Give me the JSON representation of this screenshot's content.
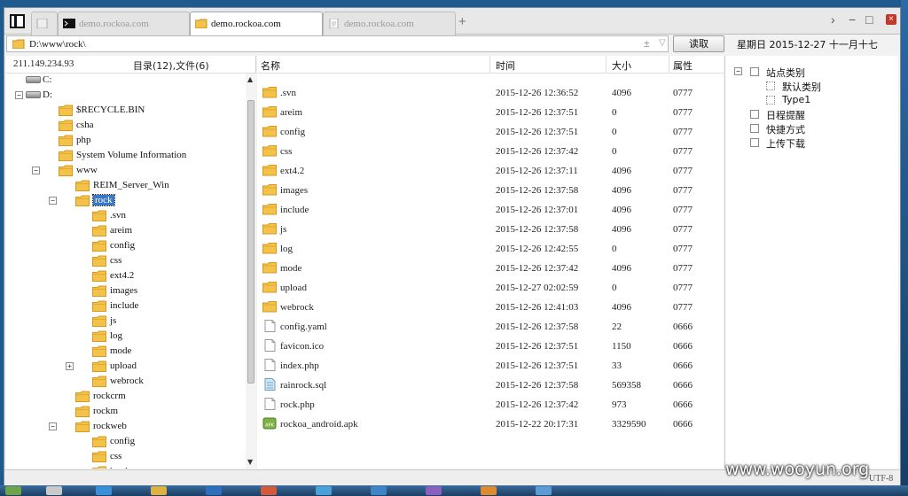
{
  "tabs": [
    {
      "icon": "blank-page-icon",
      "label": ""
    },
    {
      "icon": "terminal-icon",
      "label": "demo.rockoa.com"
    },
    {
      "icon": "folder-icon",
      "label": "demo.rockoa.com",
      "active": true
    },
    {
      "icon": "page-icon",
      "label": "demo.rockoa.com"
    }
  ],
  "toolbar": {
    "add_tab": "+",
    "forward": "›",
    "minimize": "−",
    "maximize": "□",
    "close": "×",
    "address": "D:\\www\\rock\\",
    "address_plusminus": "±",
    "address_dropdown": "▽",
    "read_button": "读取",
    "date": "星期日 2015-12-27 十一月十七"
  },
  "left": {
    "ip": "211.149.234.93",
    "count": "目录(12),文件(6)",
    "tree": [
      {
        "label": "C:",
        "depth": 0,
        "kind": "drive",
        "toggle": ""
      },
      {
        "label": "D:",
        "depth": 0,
        "kind": "drive",
        "toggle": "−"
      },
      {
        "label": "$RECYCLE.BIN",
        "depth": 1,
        "kind": "folder",
        "toggle": ""
      },
      {
        "label": "csha",
        "depth": 1,
        "kind": "folder",
        "toggle": ""
      },
      {
        "label": "php",
        "depth": 1,
        "kind": "folder",
        "toggle": ""
      },
      {
        "label": "System Volume Information",
        "depth": 1,
        "kind": "folder",
        "toggle": ""
      },
      {
        "label": "www",
        "depth": 1,
        "kind": "folder",
        "toggle": "−"
      },
      {
        "label": "REIM_Server_Win",
        "depth": 2,
        "kind": "folder",
        "toggle": ""
      },
      {
        "label": "rock",
        "depth": 2,
        "kind": "folder",
        "toggle": "−",
        "selected": true
      },
      {
        "label": ".svn",
        "depth": 3,
        "kind": "folder",
        "toggle": ""
      },
      {
        "label": "areim",
        "depth": 3,
        "kind": "folder",
        "toggle": ""
      },
      {
        "label": "config",
        "depth": 3,
        "kind": "folder",
        "toggle": ""
      },
      {
        "label": "css",
        "depth": 3,
        "kind": "folder",
        "toggle": ""
      },
      {
        "label": "ext4.2",
        "depth": 3,
        "kind": "folder",
        "toggle": ""
      },
      {
        "label": "images",
        "depth": 3,
        "kind": "folder",
        "toggle": ""
      },
      {
        "label": "include",
        "depth": 3,
        "kind": "folder",
        "toggle": ""
      },
      {
        "label": "js",
        "depth": 3,
        "kind": "folder",
        "toggle": ""
      },
      {
        "label": "log",
        "depth": 3,
        "kind": "folder",
        "toggle": ""
      },
      {
        "label": "mode",
        "depth": 3,
        "kind": "folder",
        "toggle": ""
      },
      {
        "label": "upload",
        "depth": 3,
        "kind": "folder",
        "toggle": "+"
      },
      {
        "label": "webrock",
        "depth": 3,
        "kind": "folder",
        "toggle": ""
      },
      {
        "label": "rockcrm",
        "depth": 2,
        "kind": "folder",
        "toggle": ""
      },
      {
        "label": "rockm",
        "depth": 2,
        "kind": "folder",
        "toggle": ""
      },
      {
        "label": "rockweb",
        "depth": 2,
        "kind": "folder",
        "toggle": "−"
      },
      {
        "label": "config",
        "depth": 3,
        "kind": "folder",
        "toggle": ""
      },
      {
        "label": "css",
        "depth": 3,
        "kind": "folder",
        "toggle": ""
      },
      {
        "label": "html",
        "depth": 3,
        "kind": "folder",
        "toggle": ""
      }
    ]
  },
  "main": {
    "columns": {
      "name": "名称",
      "time": "时间",
      "size": "大小",
      "attr": "属性"
    },
    "files": [
      {
        "icon": "folder-icon",
        "name": ".svn",
        "time": "2015-12-26 12:36:52",
        "size": "4096",
        "attr": "0777"
      },
      {
        "icon": "folder-icon",
        "name": "areim",
        "time": "2015-12-26 12:37:51",
        "size": "0",
        "attr": "0777"
      },
      {
        "icon": "folder-icon",
        "name": "config",
        "time": "2015-12-26 12:37:51",
        "size": "0",
        "attr": "0777"
      },
      {
        "icon": "folder-icon",
        "name": "css",
        "time": "2015-12-26 12:37:42",
        "size": "0",
        "attr": "0777"
      },
      {
        "icon": "folder-icon",
        "name": "ext4.2",
        "time": "2015-12-26 12:37:11",
        "size": "4096",
        "attr": "0777"
      },
      {
        "icon": "folder-icon",
        "name": "images",
        "time": "2015-12-26 12:37:58",
        "size": "4096",
        "attr": "0777"
      },
      {
        "icon": "folder-icon",
        "name": "include",
        "time": "2015-12-26 12:37:01",
        "size": "4096",
        "attr": "0777"
      },
      {
        "icon": "folder-icon",
        "name": "js",
        "time": "2015-12-26 12:37:58",
        "size": "4096",
        "attr": "0777"
      },
      {
        "icon": "folder-icon",
        "name": "log",
        "time": "2015-12-26 12:42:55",
        "size": "0",
        "attr": "0777"
      },
      {
        "icon": "folder-icon",
        "name": "mode",
        "time": "2015-12-26 12:37:42",
        "size": "4096",
        "attr": "0777"
      },
      {
        "icon": "folder-icon",
        "name": "upload",
        "time": "2015-12-27 02:02:59",
        "size": "0",
        "attr": "0777"
      },
      {
        "icon": "folder-icon",
        "name": "webrock",
        "time": "2015-12-26 12:41:03",
        "size": "4096",
        "attr": "0777"
      },
      {
        "icon": "file-icon",
        "name": "config.yaml",
        "time": "2015-12-26 12:37:58",
        "size": "22",
        "attr": "0666"
      },
      {
        "icon": "file-icon",
        "name": "favicon.ico",
        "time": "2015-12-26 12:37:51",
        "size": "1150",
        "attr": "0666"
      },
      {
        "icon": "file-icon",
        "name": "index.php",
        "time": "2015-12-26 12:37:51",
        "size": "33",
        "attr": "0666"
      },
      {
        "icon": "sql-file-icon",
        "name": "rainrock.sql",
        "time": "2015-12-26 12:37:58",
        "size": "569358",
        "attr": "0666"
      },
      {
        "icon": "file-icon",
        "name": "rock.php",
        "time": "2015-12-26 12:37:42",
        "size": "973",
        "attr": "0666"
      },
      {
        "icon": "apk-file-icon",
        "name": "rockoa_android.apk",
        "time": "2015-12-22 20:17:31",
        "size": "3329590",
        "attr": "0666"
      }
    ]
  },
  "right": {
    "items": [
      {
        "label": "站点类别",
        "depth": 0,
        "icon": "category-icon",
        "toggle": "−"
      },
      {
        "label": "默认类别",
        "depth": 1,
        "icon": "item-icon",
        "toggle": ""
      },
      {
        "label": "Type1",
        "depth": 1,
        "icon": "item-icon",
        "toggle": ""
      },
      {
        "label": "日程提醒",
        "depth": 0,
        "icon": "clock-icon",
        "toggle": ""
      },
      {
        "label": "快捷方式",
        "depth": 0,
        "icon": "shortcut-icon",
        "toggle": ""
      },
      {
        "label": "上传下载",
        "depth": 0,
        "icon": "transfer-icon",
        "toggle": ""
      }
    ]
  },
  "status": {
    "encoding": "UTF-8"
  },
  "watermark": "www.wooyun.org",
  "colors": {
    "folder": "#f3c24a",
    "folder_dark": "#d79a1f",
    "selection": "#3a77c9",
    "close": "#c0392b"
  }
}
